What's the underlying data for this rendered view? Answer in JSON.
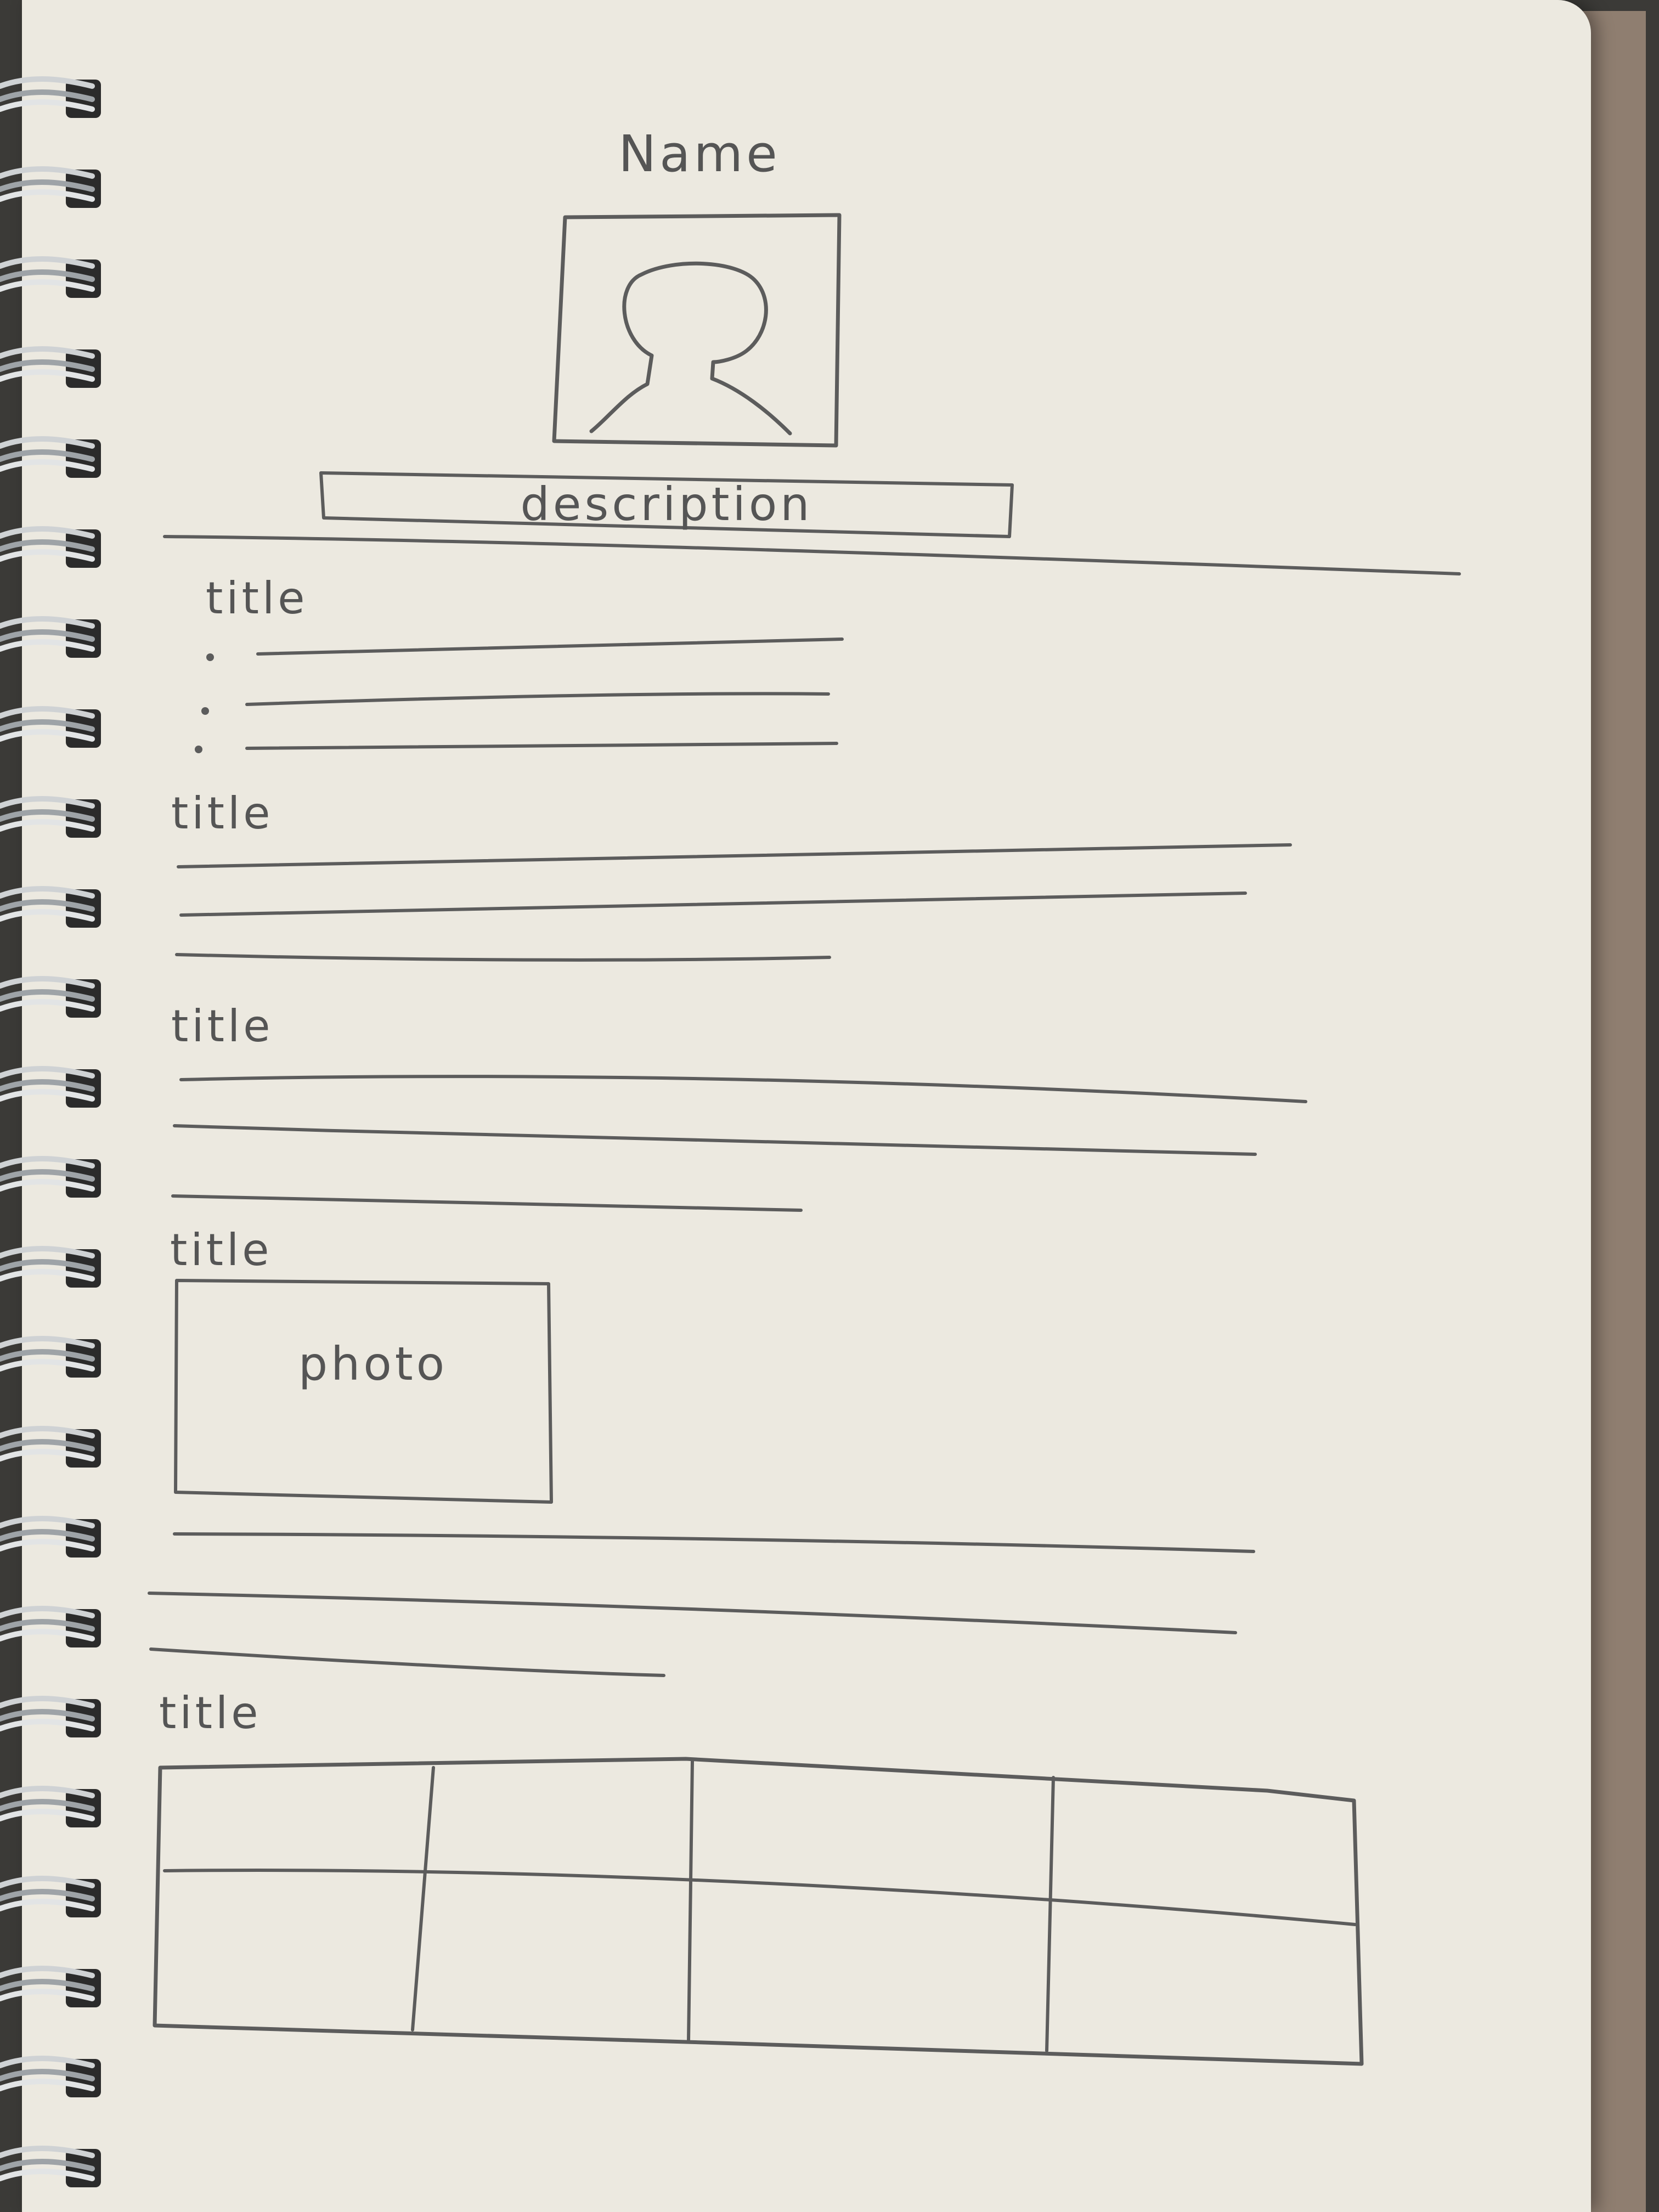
{
  "profile": {
    "name": "Name",
    "avatar": "person-silhouette-icon",
    "description": "description"
  },
  "sections": [
    {
      "title": "title",
      "kind": "bullet-list",
      "bullet_count": 3
    },
    {
      "title": "title",
      "kind": "paragraph",
      "line_count": 3
    },
    {
      "title": "title",
      "kind": "paragraph",
      "line_count": 3
    },
    {
      "title": "title",
      "kind": "photo-with-text",
      "photo_label": "photo",
      "line_count": 3
    },
    {
      "title": "title",
      "kind": "table",
      "rows": 2,
      "columns": 4
    }
  ],
  "colors": {
    "paper": "#ece9e0",
    "pencil": "#5c5c5c",
    "binding": "#2b2b2b",
    "cover": "#8f7e70"
  }
}
